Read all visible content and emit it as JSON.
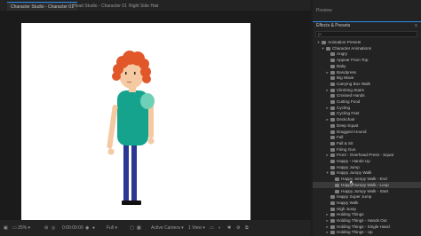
{
  "tabs": [
    {
      "label": "Character Studio - Character 01",
      "active": true
    },
    {
      "label": "Head Studio - Character 01",
      "active": false
    },
    {
      "label": "Right Side Hair",
      "active": false
    }
  ],
  "status": {
    "zoom": "25%",
    "timecode": "0:00:00:00",
    "resolution": "Full",
    "camera": "Active Camera",
    "views": "1 View"
  },
  "panel": {
    "preview_title": "Preview",
    "effects_title": "Effects & Presets",
    "menu_icon": "≡",
    "search_value": "ρ-",
    "tree": [
      {
        "label": "Animation Presets",
        "depth": 0,
        "chev": "open"
      },
      {
        "label": "Character Animations",
        "depth": 1,
        "chev": "open"
      },
      {
        "label": "Angry",
        "depth": 2,
        "chev": "none"
      },
      {
        "label": "Appear From Top",
        "depth": 2,
        "chev": "none"
      },
      {
        "label": "Baby",
        "depth": 2,
        "chev": "none"
      },
      {
        "label": "Bandpress",
        "depth": 2,
        "chev": "closed"
      },
      {
        "label": "Big Wave",
        "depth": 2,
        "chev": "none"
      },
      {
        "label": "Carrying Box Walk",
        "depth": 2,
        "chev": "none"
      },
      {
        "label": "Climbing Stairs",
        "depth": 2,
        "chev": "closed"
      },
      {
        "label": "Crossed Hands",
        "depth": 2,
        "chev": "none"
      },
      {
        "label": "Cutting Food",
        "depth": 2,
        "chev": "none"
      },
      {
        "label": "Cycling",
        "depth": 2,
        "chev": "closed"
      },
      {
        "label": "Cycling Fast",
        "depth": 2,
        "chev": "none"
      },
      {
        "label": "Deckchair",
        "depth": 2,
        "chev": "closed"
      },
      {
        "label": "Deep Squat",
        "depth": 2,
        "chev": "none"
      },
      {
        "label": "Dragged Around",
        "depth": 2,
        "chev": "none"
      },
      {
        "label": "Fall",
        "depth": 2,
        "chev": "none"
      },
      {
        "label": "Fall & Sit",
        "depth": 2,
        "chev": "none"
      },
      {
        "label": "Firing Gun",
        "depth": 2,
        "chev": "none"
      },
      {
        "label": "Front - Overhead Press - Squat",
        "depth": 2,
        "chev": "closed"
      },
      {
        "label": "Happy - Hands Up",
        "depth": 2,
        "chev": "none"
      },
      {
        "label": "Happy Jump",
        "depth": 2,
        "chev": "none"
      },
      {
        "label": "Happy Jumpy Walk",
        "depth": 2,
        "chev": "open"
      },
      {
        "label": "Happy Jumpy Walk - End",
        "depth": 3,
        "chev": "none"
      },
      {
        "label": "Happy Jumpy Walk - Loop",
        "depth": 3,
        "chev": "none",
        "selected": true
      },
      {
        "label": "Happy Jumpy Walk - Start",
        "depth": 3,
        "chev": "none"
      },
      {
        "label": "Happy Super Jump",
        "depth": 2,
        "chev": "none"
      },
      {
        "label": "Happy Walk",
        "depth": 2,
        "chev": "none"
      },
      {
        "label": "High Jump",
        "depth": 2,
        "chev": "none"
      },
      {
        "label": "Holding Things",
        "depth": 2,
        "chev": "closed"
      },
      {
        "label": "Holding Things - Hands Out",
        "depth": 2,
        "chev": "closed"
      },
      {
        "label": "Holding Things - Single Hand",
        "depth": 2,
        "chev": "closed"
      },
      {
        "label": "Holding Things - Up",
        "depth": 2,
        "chev": "closed"
      }
    ]
  },
  "colors": {
    "accent": "#2d8ceb",
    "hair": "#e2572a",
    "shirt": "#15a38e",
    "pants": "#2a3793",
    "skin": "#f5c9a1"
  }
}
